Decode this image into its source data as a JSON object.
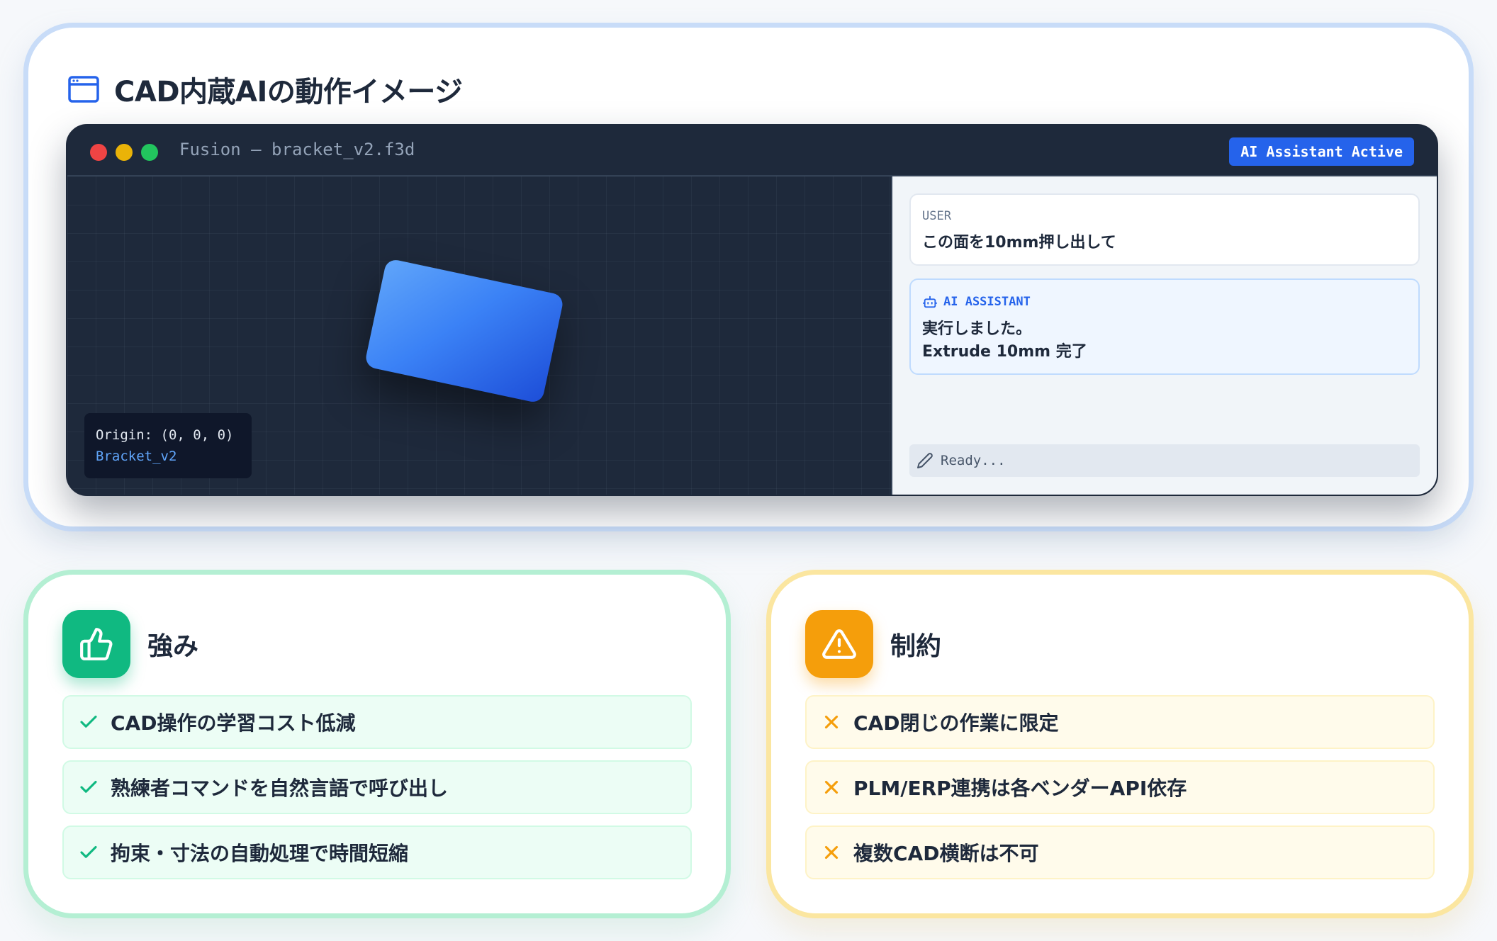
{
  "header": {
    "title": "CAD内蔵AIの動作イメージ"
  },
  "cad_window": {
    "title": "Fusion — bracket_v2.f3d",
    "badge": "AI Assistant Active",
    "viewport": {
      "origin_label": "Origin: (0, 0, 0)",
      "object_name": "Bracket_v2"
    },
    "chat": {
      "user_role": "USER",
      "user_message": "この面を10mm押し出して",
      "ai_role": "AI ASSISTANT",
      "ai_message_line1": "実行しました。",
      "ai_message_line2": "Extrude 10mm 完了",
      "input_status": "Ready..."
    }
  },
  "strengths": {
    "title": "強み",
    "items": [
      "CAD操作の学習コスト低減",
      "熟練者コマンドを自然言語で呼び出し",
      "拘束・寸法の自動処理で時間短縮"
    ]
  },
  "limits": {
    "title": "制約",
    "items": [
      "CAD閉じの作業に限定",
      "PLM/ERP連携は各ベンダーAPI依存",
      "複数CAD横断は不可"
    ]
  },
  "colors": {
    "accent_blue": "#2563eb",
    "strength_green": "#10b981",
    "limit_amber": "#f59e0b",
    "window_dark": "#1e293b"
  }
}
